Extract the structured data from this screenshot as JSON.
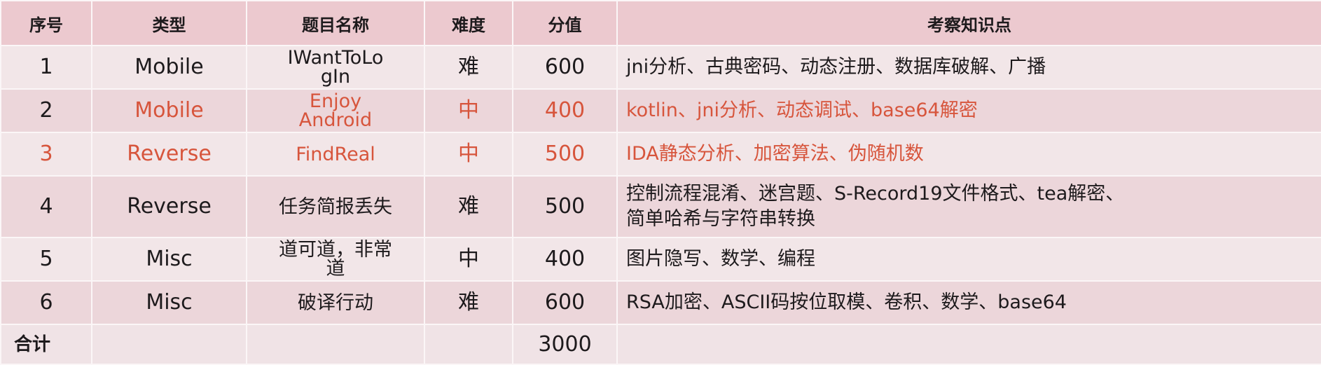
{
  "headers": [
    "序号",
    "类型",
    "题目名称",
    "难度",
    "分值",
    "考察知识点"
  ],
  "rows": [
    {
      "no": "1",
      "type": "Mobile",
      "name": "IWantToLo\ngIn",
      "difficulty": "难",
      "score": "600",
      "points": "jni分析、古典密码、动态注册、数据库破解、广播"
    },
    {
      "no": "2",
      "type": "Mobile",
      "name": "Enjoy\nAndroid",
      "difficulty": "中",
      "score": "400",
      "points": "kotlin、jni分析、动态调试、base64解密"
    },
    {
      "no": "3",
      "type": "Reverse",
      "name": "FindReal",
      "difficulty": "中",
      "score": "500",
      "points": "IDA静态分析、加密算法、伪随机数"
    },
    {
      "no": "4",
      "type": "Reverse",
      "name": "任务简报丢失",
      "difficulty": "难",
      "score": "500",
      "points": "控制流程混淆、迷宫题、S-Record19文件格式、tea解密、\n简单哈希与字符串转换"
    },
    {
      "no": "5",
      "type": "Misc",
      "name": "道可道，非常\n道",
      "difficulty": "中",
      "score": "400",
      "points": "图片隐写、数学、编程"
    },
    {
      "no": "6",
      "type": "Misc",
      "name": "破译行动",
      "difficulty": "难",
      "score": "600",
      "points": "RSA加密、ASCII码按位取模、卷积、数学、base64"
    }
  ],
  "total": {
    "label": "合计",
    "score": "3000"
  },
  "highlight_color": "#d7553c"
}
